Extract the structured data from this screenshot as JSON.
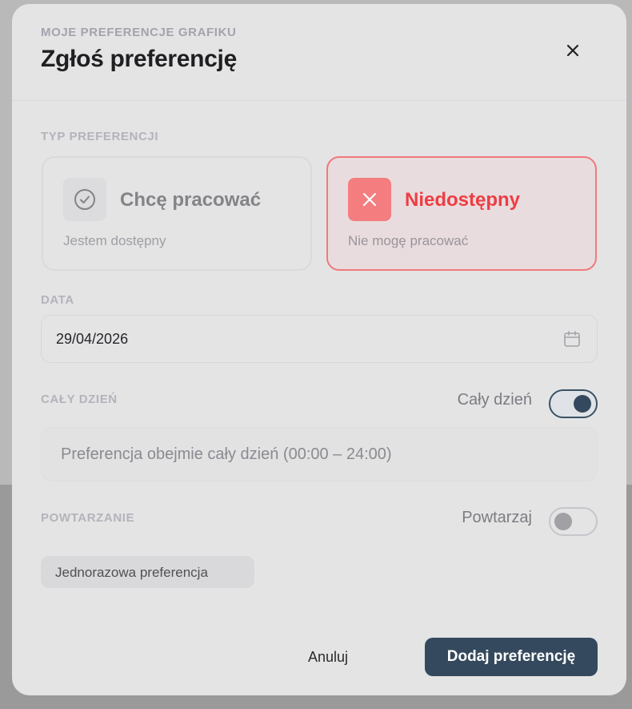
{
  "header": {
    "eyebrow": "MOJE PREFERENCJE GRAFIKU",
    "title": "Zgłoś preferencję"
  },
  "preference_type": {
    "label": "TYP PREFERENCJI",
    "options": [
      {
        "title": "Chcę pracować",
        "subtitle": "Jestem dostępny",
        "icon": "check-circle-icon",
        "selected": false
      },
      {
        "title": "Niedostępny",
        "subtitle": "Nie mogę pracować",
        "icon": "x-icon",
        "selected": true
      }
    ]
  },
  "date": {
    "label": "DATA",
    "value": "29/04/2026"
  },
  "all_day": {
    "label": "CAŁY DZIEŃ",
    "toggle_label": "Cały dzień",
    "enabled": true,
    "info": "Preferencja obejmie cały dzień (00:00 – 24:00)"
  },
  "repeat": {
    "label": "POWTARZANIE",
    "toggle_label": "Powtarzaj",
    "enabled": false,
    "chip": "Jednorazowa preferencja"
  },
  "footer": {
    "cancel": "Anuluj",
    "submit": "Dodaj preferencję"
  },
  "colors": {
    "accent": "#34495d",
    "danger": "#ee3d43",
    "danger_bg": "#f37d7f"
  }
}
